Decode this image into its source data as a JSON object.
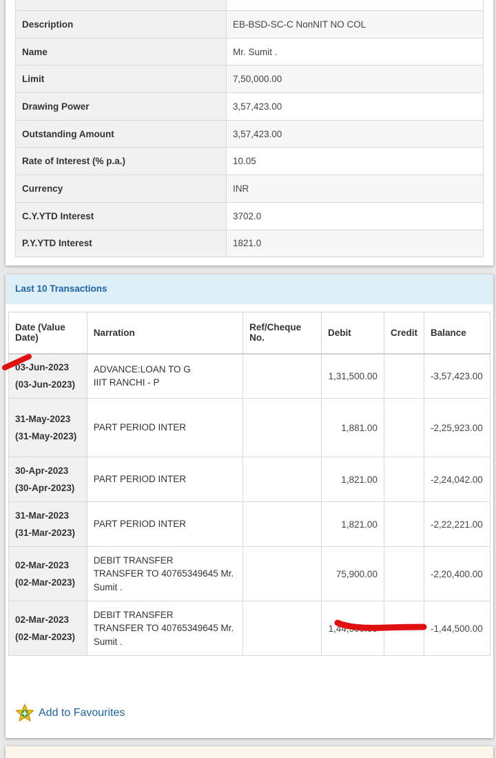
{
  "details": {
    "rows": [
      {
        "label": "",
        "value": ""
      },
      {
        "label": "Description",
        "value": "EB-BSD-SC-C NonNIT NO COL"
      },
      {
        "label": "Name",
        "value": "Mr. Sumit ."
      },
      {
        "label": "Limit",
        "value": "7,50,000.00"
      },
      {
        "label": "Drawing Power",
        "value": "3,57,423.00"
      },
      {
        "label": "Outstanding Amount",
        "value": "3,57,423.00"
      },
      {
        "label": "Rate of Interest (% p.a.)",
        "value": "10.05"
      },
      {
        "label": "Currency",
        "value": "INR"
      },
      {
        "label": "C.Y.YTD Interest",
        "value": "3702.0"
      },
      {
        "label": "P.Y.YTD Interest",
        "value": "1821.0"
      }
    ]
  },
  "transactions": {
    "title": "Last 10 Transactions",
    "columns": {
      "date": "Date (Value Date)",
      "narration": "Narration",
      "ref": "Ref/Cheque No.",
      "debit": "Debit",
      "credit": "Credit",
      "balance": "Balance"
    },
    "rows": [
      {
        "date": "03-Jun-2023",
        "value_date": "(03-Jun-2023)",
        "narration": [
          "ADVANCE:LOAN TO G",
          "IIIT RANCHI - P"
        ],
        "ref": "",
        "debit": "1,31,500.00",
        "credit": "",
        "balance": "-3,57,423.00"
      },
      {
        "date": "31-May-2023",
        "value_date": "(31-May-2023)",
        "narration": [
          "PART PERIOD INTER"
        ],
        "ref": "",
        "debit": "1,881.00",
        "credit": "",
        "balance": "-2,25,923.00"
      },
      {
        "date": "30-Apr-2023",
        "value_date": "(30-Apr-2023)",
        "narration": [
          "PART PERIOD INTER"
        ],
        "ref": "",
        "debit": "1,821.00",
        "credit": "",
        "balance": "-2,24,042.00"
      },
      {
        "date": "31-Mar-2023",
        "value_date": "(31-Mar-2023)",
        "narration": [
          "PART PERIOD INTER"
        ],
        "ref": "",
        "debit": "1,821.00",
        "credit": "",
        "balance": "-2,22,221.00"
      },
      {
        "date": "02-Mar-2023",
        "value_date": "(02-Mar-2023)",
        "narration": [
          "DEBIT TRANSFER",
          "TRANSFER TO 40765349645 Mr.",
          "Sumit ."
        ],
        "ref": "",
        "debit": "75,900.00",
        "credit": "",
        "balance": "-2,20,400.00"
      },
      {
        "date": "02-Mar-2023",
        "value_date": "(02-Mar-2023)",
        "narration": [
          "DEBIT TRANSFER",
          "TRANSFER TO 40765349645 Mr.",
          "Sumit ."
        ],
        "ref": "",
        "debit": "1,44,500.00",
        "credit": "",
        "balance": "-1,44,500.00"
      }
    ]
  },
  "favourites": {
    "label": "Add to Favourites",
    "icon": "star-plus-icon"
  },
  "colors": {
    "link": "#1e62a8",
    "header_bg": "#ddeef6",
    "label_bg": "#f1f1f1",
    "annotation": "#e01010"
  }
}
